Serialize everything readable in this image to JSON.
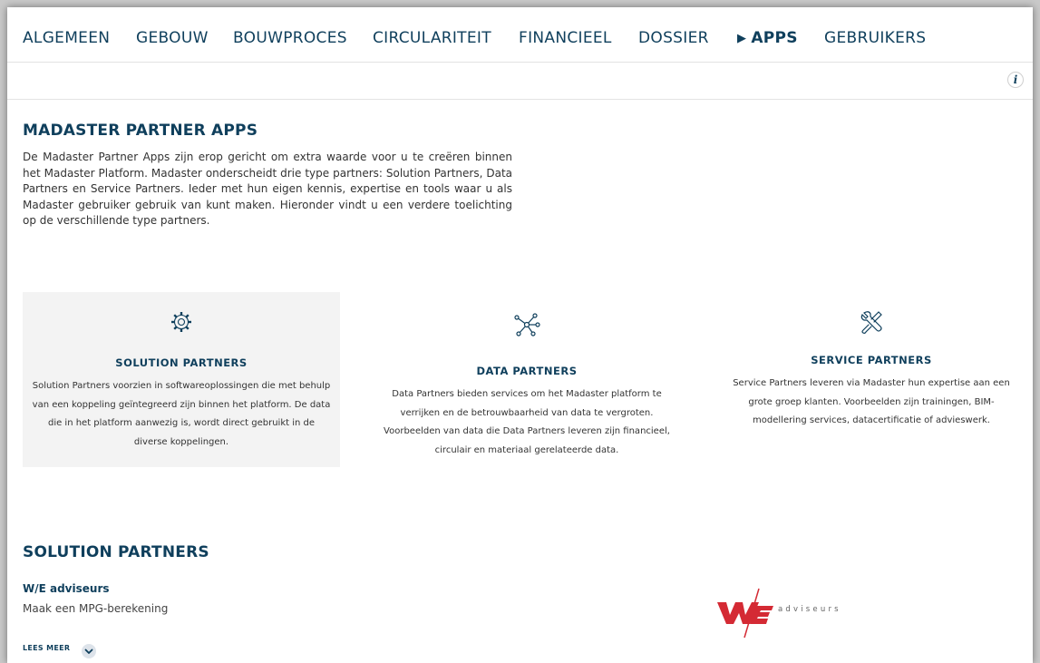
{
  "nav": {
    "items": [
      "ALGEMEEN",
      "GEBOUW",
      "BOUWPROCES",
      "CIRCULARITEIT",
      "FINANCIEEL",
      "DOSSIER",
      "APPS",
      "GEBRUIKERS"
    ],
    "active": "APPS"
  },
  "info_label": "i",
  "main": {
    "title": "MADASTER PARTNER APPS",
    "intro": "De Madaster Partner Apps zijn erop gericht om extra waarde voor u te creëren binnen het Madaster Platform. Madaster onderscheidt drie type partners: Solution Partners, Data Partners en Service Partners. Ieder met hun eigen kennis, expertise en tools waar u als Madaster gebruiker gebruik van kunt maken. Hieronder vindt u een verdere toelichting op de verschillende type partners."
  },
  "partner_types": [
    {
      "icon": "gear-icon",
      "title": "SOLUTION PARTNERS",
      "description": "Solution Partners voorzien in softwareoplossingen die met behulp van een koppeling geïntegreerd zijn binnen het platform. De data die in het platform aanwezig is, wordt direct gebruikt in de diverse koppelingen."
    },
    {
      "icon": "network-nodes-icon",
      "title": "DATA PARTNERS",
      "description": "Data Partners bieden services om het Madaster platform te verrijken en de betrouwbaarheid van data te vergroten. Voorbeelden van data die Data Partners leveren zijn financieel, circulair en materiaal gerelateerde data."
    },
    {
      "icon": "tools-icon",
      "title": "SERVICE PARTNERS",
      "description": "Service Partners leveren via Madaster hun expertise aan een grote groep klanten. Voorbeelden zijn trainingen, BIM-modellering services, datacertificatie of advieswerk."
    }
  ],
  "solution_section": {
    "title": "SOLUTION PARTNERS",
    "partner": {
      "name": "W/E adviseurs",
      "description": "Maak een MPG-berekening",
      "read_more": "LEES MEER",
      "logo_text": "adviseurs"
    }
  },
  "colors": {
    "primary": "#0f3f5c",
    "card_highlight": "#f3f3f3",
    "logo_red": "#d42a34"
  }
}
